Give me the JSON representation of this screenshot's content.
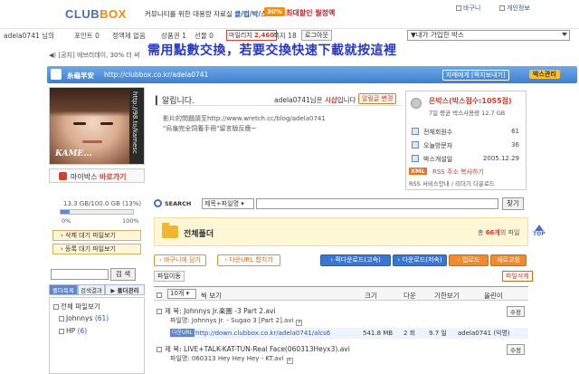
{
  "header": {
    "logo_main": "CLUB",
    "logo_accent": "BOX",
    "tagline_prefix": "커뮤니티를 위한 대용량 자료실",
    "tagline_highlight": "클/럽/박/스",
    "promo_pct": "30%",
    "promo_text": "최대할인 월정액",
    "cart": "바구니",
    "my_info": "개인정보"
  },
  "user_bar": {
    "greeting": "adela0741 님의",
    "points": "포인트 0",
    "fixed_plan": "정액제 없음",
    "coupon": "상품권 1",
    "gift": "선물 0",
    "mileage_label": "마일리지",
    "mileage_value": "2,460",
    "notes": "쪽지 18",
    "logout": "로그아웃",
    "box_select": "▼내가 가입한 박스"
  },
  "notice": {
    "text": "[공지] 에브리데이, 30% 더 써",
    "overlay_cn": "需用點數交換，若要交換快速下載就按這裡"
  },
  "site_bar": {
    "name": "糸龜早安",
    "url": "http://clubbox.co.kr/adela0741",
    "sister_button": "자매에게 [쪽지보내기]",
    "manage_button": "박스관리"
  },
  "profile": {
    "side_text": "http://98.to/kamesc",
    "caption": "KAME...",
    "shortcut_label": "마이박스",
    "shortcut_go": "바로가기"
  },
  "usage": {
    "text": "13.3 GB/100.0 GB (13%)",
    "percent": 13,
    "min_label": "0%",
    "max_label": "100%",
    "btn_delete_wait": "삭제 대기 파일보기",
    "btn_register_wait": "등록 대기 파일보기"
  },
  "left_search": {
    "button": "검 색"
  },
  "folder_panel": {
    "tab_folders": "폴더목록",
    "tab_results": "검색결과",
    "tab_manage": "폴더관리",
    "items": [
      {
        "label": "전체 파일보기",
        "count": ""
      },
      {
        "label": "Johnnys",
        "count": "(61)"
      },
      {
        "label": "HP",
        "count": "(6)"
      }
    ]
  },
  "alarm": {
    "title": "알립니다.",
    "user_prefix": "adela0741님은",
    "user_status": "시샵",
    "user_suffix": "입니다",
    "change_button": "알림글 변경",
    "line1": "影片的問題請至http://www.wretch.cc/blog/adela0741",
    "line2": "\"烏龜完全饲養手冊\"留言版反應~"
  },
  "info_panel": {
    "grade": "은박스(박스점수:1055점)",
    "grade_sub": "7일 평균 박스사용량 12.7 GB",
    "stats": [
      {
        "label": "전체회원수",
        "value": "61"
      },
      {
        "label": "오늘방문자",
        "value": "36"
      },
      {
        "label": "박스개설일",
        "value": "2005.12.29"
      }
    ],
    "xml_badge": "XML",
    "rss_copy": "RSS 주소 복사하기",
    "rss_service": "RSS 서비스안내 / 리더기 다운로드"
  },
  "top_button": "TOP",
  "search": {
    "label": "SEARCH",
    "type": "제목+파일명",
    "button": "찾기"
  },
  "folder_header": {
    "title": "전체폴더",
    "count_prefix": "총",
    "count_value": "66개",
    "count_suffix": "의 파일"
  },
  "actions": {
    "cart": "바구니에 담기",
    "bulk_url": "다운URL 합치기",
    "fast_download": "퀵다운로드(고속)",
    "download": "다운로드(저속)",
    "upload": "업로드",
    "refresh": "새로고침",
    "file_move": "파일이동",
    "file_delete": "파일삭제"
  },
  "table": {
    "per_page": "10개",
    "columns": [
      "씩 보기",
      "크기",
      "다운",
      "기한보기",
      "올린이"
    ],
    "rows": [
      {
        "title": "제   목: Johnnys Jr.楽園 -3 Part 2.avi",
        "filename": "파일명: Johnnys Jr. - Sugao 3 [Part 2].avi",
        "revise": "수정",
        "url_tag": "다운URL",
        "url": "http://down.clubbox.co.kr/adela0741/alcs6",
        "size": "541.8 MB",
        "downloads": "2 회",
        "date": "9.7 일",
        "uploader": "adela0741 (익명)"
      },
      {
        "title": "제   목: LIVE+TALK-KAT-TUN-Real Face(060313Heyx3).avi",
        "filename": "파일명: 060313 Hey Hey Hey - KT.avi",
        "revise": "수정"
      }
    ]
  }
}
